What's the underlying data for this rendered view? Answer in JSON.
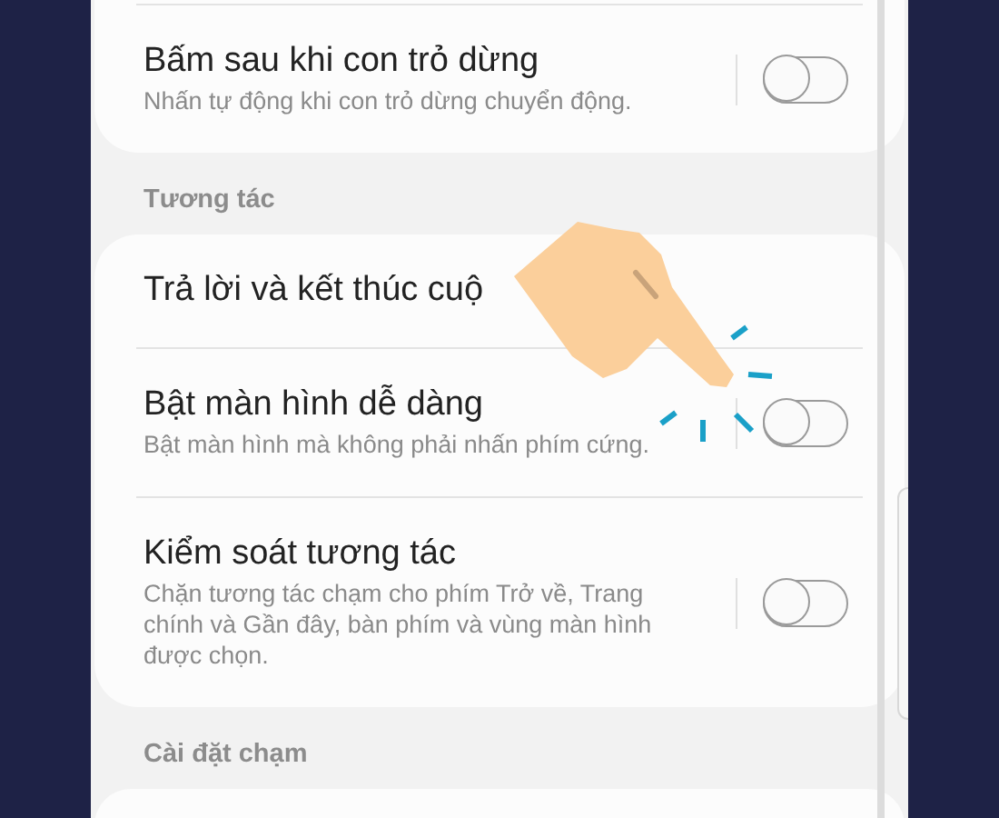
{
  "sections": [
    {
      "items": [
        {
          "kind": "toggle",
          "title": "Bấm sau khi con trỏ dừng",
          "subtitle": "Nhấn tự động khi con trỏ dừng chuyển động.",
          "on": false
        }
      ]
    },
    {
      "header": "Tương tác",
      "items": [
        {
          "kind": "link",
          "title": "Trả lời và kết thúc cuộ"
        },
        {
          "kind": "toggle",
          "title": "Bật màn hình dễ dàng",
          "subtitle": "Bật màn hình mà không phải nhấn phím cứng.",
          "on": false
        },
        {
          "kind": "toggle",
          "title": "Kiểm soát tương tác",
          "subtitle": "Chặn tương tác chạm cho phím Trở về, Trang chính và Gần đây, bàn phím và vùng màn hình được chọn.",
          "on": false
        }
      ]
    },
    {
      "header": "Cài đặt chạm"
    }
  ]
}
